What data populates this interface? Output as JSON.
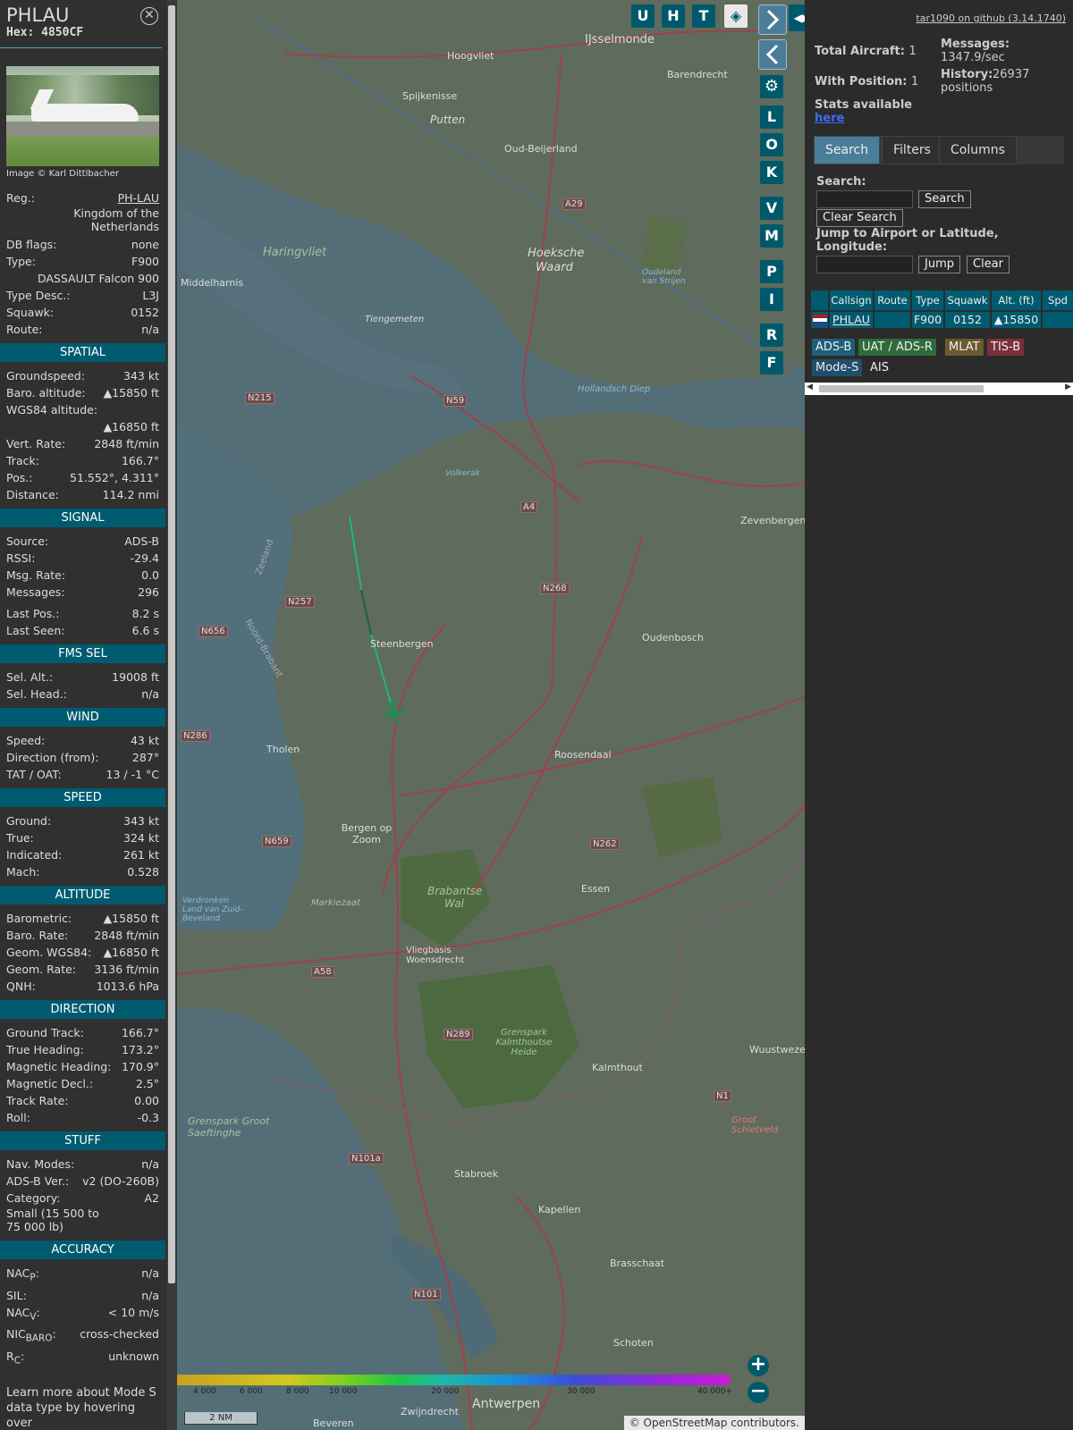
{
  "aircraft": {
    "callsign": "PHLAU",
    "hex_label": "Hex: 4850CF",
    "photo_credit": "Image © Karl Dittlbacher",
    "registration_label": "Reg.:",
    "registration": "PH-LAU",
    "country": "Kingdom of the Netherlands",
    "db_flags_label": "DB flags:",
    "db_flags": "none",
    "type_label": "Type:",
    "type": "F900",
    "type_name": "DASSAULT Falcon 900",
    "type_desc_label": "Type Desc.:",
    "type_desc": "L3J",
    "squawk_label": "Squawk:",
    "squawk": "0152",
    "route_label": "Route:",
    "route": "n/a"
  },
  "sections": {
    "spatial": "SPATIAL",
    "signal": "SIGNAL",
    "fms": "FMS SEL",
    "wind": "WIND",
    "speed": "SPEED",
    "altitude": "ALTITUDE",
    "direction": "DIRECTION",
    "stuff": "STUFF",
    "accuracy": "ACCURACY"
  },
  "spatial": {
    "groundspeed_label": "Groundspeed:",
    "groundspeed": "343 kt",
    "baro_alt_label": "Baro. altitude:",
    "baro_alt": "▲15850 ft",
    "wgs84_alt_label": "WGS84 altitude:",
    "wgs84_alt": "▲16850 ft",
    "vert_rate_label": "Vert. Rate:",
    "vert_rate": "2848 ft/min",
    "track_label": "Track:",
    "track": "166.7°",
    "pos_label": "Pos.:",
    "pos": "51.552°, 4.311°",
    "distance_label": "Distance:",
    "distance": "114.2 nmi"
  },
  "signal": {
    "source_label": "Source:",
    "source": "ADS-B",
    "rssi_label": "RSSI:",
    "rssi": "-29.4",
    "msg_rate_label": "Msg. Rate:",
    "msg_rate": "0.0",
    "messages_label": "Messages:",
    "messages": "296",
    "last_pos_label": "Last Pos.:",
    "last_pos": "8.2 s",
    "last_seen_label": "Last Seen:",
    "last_seen": "6.6 s"
  },
  "fms": {
    "sel_alt_label": "Sel. Alt.:",
    "sel_alt": "19008 ft",
    "sel_head_label": "Sel. Head.:",
    "sel_head": "n/a"
  },
  "wind": {
    "speed_label": "Speed:",
    "speed": "43 kt",
    "dir_label": "Direction (from):",
    "dir": "287°",
    "tat_label": "TAT / OAT:",
    "tat": "13 / -1 °C"
  },
  "speed": {
    "ground_label": "Ground:",
    "ground": "343 kt",
    "true_label": "True:",
    "true": "324 kt",
    "indicated_label": "Indicated:",
    "indicated": "261 kt",
    "mach_label": "Mach:",
    "mach": "0.528"
  },
  "altitude": {
    "baro_label": "Barometric:",
    "baro": "▲15850 ft",
    "baro_rate_label": "Baro. Rate:",
    "baro_rate": "2848 ft/min",
    "geom_label": "Geom. WGS84:",
    "geom": "▲16850 ft",
    "geom_rate_label": "Geom. Rate:",
    "geom_rate": "3136 ft/min",
    "qnh_label": "QNH:",
    "qnh": "1013.6 hPa"
  },
  "direction": {
    "ground_track_label": "Ground Track:",
    "ground_track": "166.7°",
    "true_heading_label": "True Heading:",
    "true_heading": "173.2°",
    "mag_heading_label": "Magnetic Heading:",
    "mag_heading": "170.9°",
    "mag_decl_label": "Magnetic Decl.:",
    "mag_decl": "2.5°",
    "track_rate_label": "Track Rate:",
    "track_rate": "0.00",
    "roll_label": "Roll:",
    "roll": "-0.3"
  },
  "stuff": {
    "nav_modes_label": "Nav. Modes:",
    "nav_modes": "n/a",
    "adsb_ver_label": "ADS-B Ver.:",
    "adsb_ver": "v2 (DO-260B)",
    "category_label": "Category:",
    "category": "A2",
    "category_desc": "Small (15 500 to 75 000 lb)"
  },
  "accuracy": {
    "nacp_label": "NAC",
    "nacp_sub": "P",
    "nacp": "n/a",
    "sil_label": "SIL:",
    "sil": "n/a",
    "nacv_label": "NAC",
    "nacv_sub": "V",
    "nacv": "< 10 m/s",
    "nicbaro_label": "NIC",
    "nicbaro_sub": "BARO",
    "nicbaro": "cross-checked",
    "rc_label": "R",
    "rc_sub": "C",
    "rc": "unknown"
  },
  "learn_more": "Learn more about Mode S data type by hovering over",
  "map": {
    "buttons": [
      "U",
      "H",
      "T"
    ],
    "side_buttons": [
      "L",
      "O",
      "K",
      "V",
      "M",
      "P",
      "I",
      "R",
      "F"
    ],
    "place_labels": [
      "IJsselmonde",
      "Hoogvliet",
      "Barendrecht",
      "Spijkenisse",
      "Putten",
      "Oud-Beijerland",
      "Hoeksche Waard",
      "Haringvliet",
      "Middelharnis",
      "Tiengemeten",
      "Oudeland van Strijen",
      "Hollandsch Diep",
      "Volkerak",
      "Zevenbergen",
      "Steenbergen",
      "Oudenbosch",
      "Tholen",
      "Roosendaal",
      "Bergen op Zoom",
      "Brabantse Wal",
      "Essen",
      "Markiezaat",
      "Vliegbasis Woensdrecht",
      "Grenspark Kalmthoutse Heide",
      "Kalmthout",
      "Wuustwezel",
      "Grenspark Groot Saeftinghe",
      "Stabroek",
      "Kapellen",
      "Brasschaat",
      "Schoten",
      "Antwerpen",
      "Zwijndrecht",
      "Beveren",
      "Groot Schietveld",
      "Verdronken Land van Zuid-Beveland",
      "Zeeland",
      "Noord-Brabant"
    ],
    "road_labels": [
      "A29",
      "N59",
      "N215",
      "A4",
      "N257",
      "N268",
      "N656",
      "N286",
      "N659",
      "N262",
      "A58",
      "N289",
      "N101a",
      "N101",
      "N1"
    ],
    "legend_ticks": [
      "4 000",
      "6 000",
      "8 000",
      "10 000",
      "20 000",
      "30 000",
      "40 000+"
    ],
    "scale_label": "2 NM",
    "attribution": "© OpenStreetMap contributors."
  },
  "side": {
    "version_link": "tar1090 on github (3.14.1740)",
    "total_aircraft_label": "Total Aircraft:",
    "total_aircraft": "1",
    "with_position_label": "With Position:",
    "with_position": "1",
    "messages_label": "Messages:",
    "messages_value": "1347.9/sec",
    "history_label": "History:",
    "history_value": "26937 positions",
    "stats_text": "Stats available",
    "stats_link": "here",
    "tabs": [
      "Search",
      "Filters",
      "Columns"
    ],
    "search_label": "Search:",
    "search_button": "Search",
    "clear_search_button": "Clear Search",
    "jump_label": "Jump to Airport or Latitude, Longitude:",
    "jump_button": "Jump",
    "clear_button": "Clear",
    "columns": [
      "Callsign",
      "Route",
      "Type",
      "Squawk",
      "Alt. (ft)",
      "Spd"
    ],
    "row": {
      "callsign": "PHLAU",
      "route": "",
      "type": "F900",
      "squawk": "0152",
      "alt": "▲15850"
    },
    "sources": [
      "ADS-B",
      "UAT / ADS-R",
      "MLAT",
      "TIS-B",
      "Mode-S",
      "AIS"
    ],
    "colors": {
      "adsb": "#1f5f7a",
      "uat": "#2f6b3a",
      "mlat": "#6b5a2f",
      "tisb": "#7a2f3a",
      "modes": "#1f4f6a",
      "ais": "#2b2b2b"
    }
  }
}
